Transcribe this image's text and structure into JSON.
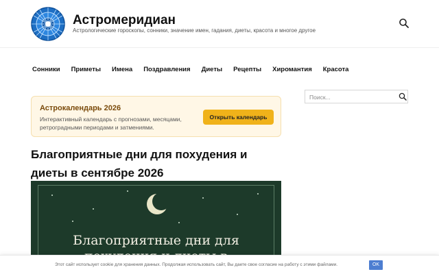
{
  "header": {
    "site_title": "Астромеридиан",
    "tagline": "Астрологические гороскопы, сонники, значение имен, гадания, диеты, красота и многое другое",
    "logo_icon": "zodiac-wheel-icon",
    "search_icon": "search-icon"
  },
  "nav": {
    "items": [
      {
        "label": "Сонники"
      },
      {
        "label": "Приметы"
      },
      {
        "label": "Имена"
      },
      {
        "label": "Поздравления"
      },
      {
        "label": "Диеты"
      },
      {
        "label": "Рецепты"
      },
      {
        "label": "Хиромантия"
      },
      {
        "label": "Красота"
      }
    ]
  },
  "promo": {
    "title": "Астрокалендарь 2026",
    "text": "Интерактивный календарь с прогнозами, месяцами, ретроградными периодами и затмениями.",
    "button_label": "Открыть календарь",
    "accent_color": "#f0b21a"
  },
  "article": {
    "title": "Благоприятные дни для похудения и диеты в сентябре 2026",
    "hero_text_line1": "Благоприятные дни для",
    "hero_text_line2": "похудения и диеты в"
  },
  "sidebar": {
    "search_placeholder": "Поиск..."
  },
  "cookie": {
    "text": "Этот сайт использует cookie для хранения данных. Продолжая использовать сайт, Вы даете свое согласие на работу с этими файлами.",
    "ok_label": "OK"
  }
}
